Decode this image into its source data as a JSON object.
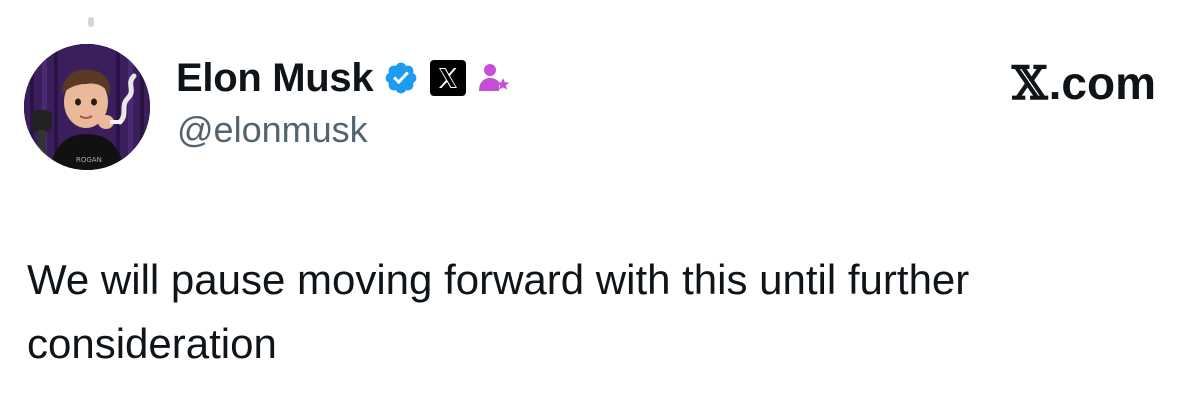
{
  "author": {
    "display_name": "Elon Musk",
    "handle": "@elonmusk"
  },
  "site": {
    "mark": "𝕏",
    "domain": ".com"
  },
  "tweet": {
    "text": "We will pause moving forward with this until further consideration"
  },
  "colors": {
    "verified_badge": "#1d9bf0",
    "affiliate_badge": "#000000",
    "host_badge": "#c44fd6",
    "handle": "#536471",
    "text": "#0f1419"
  },
  "icons": {
    "verified": "verified-badge-icon",
    "affiliate": "x-affiliate-icon",
    "host": "person-star-icon"
  }
}
